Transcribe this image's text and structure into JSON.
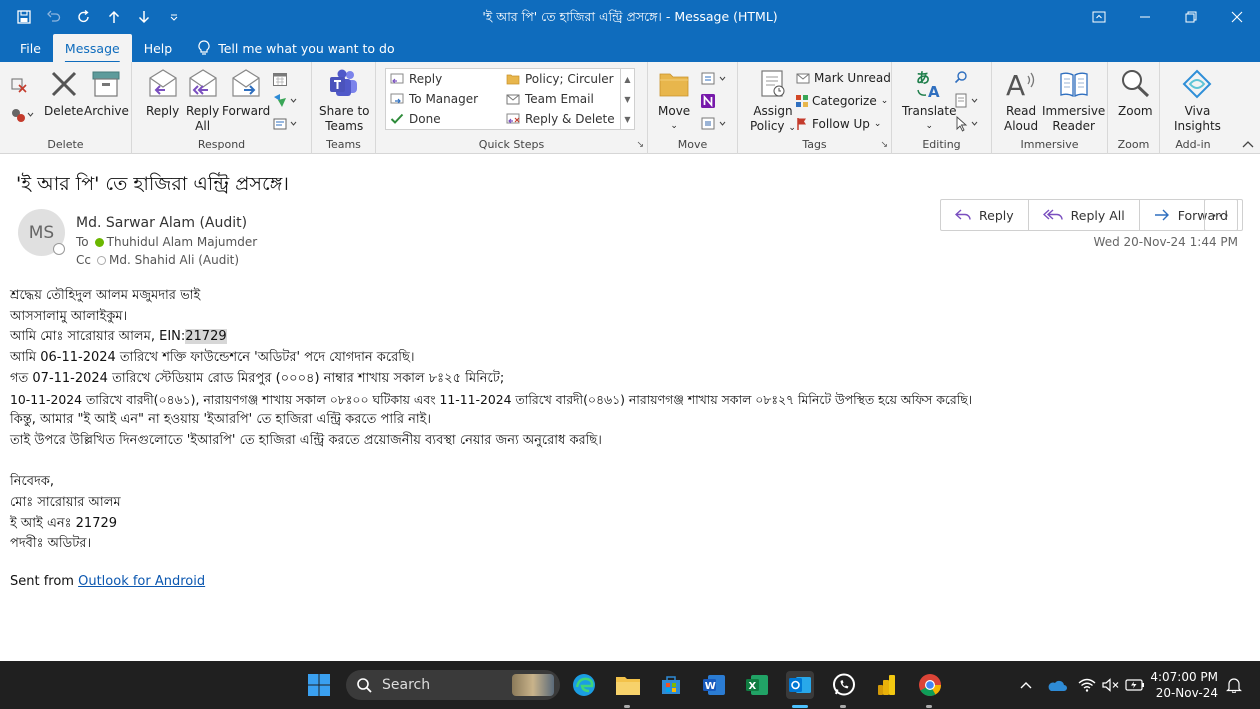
{
  "window": {
    "title": "'ই আর পি' তে হাজিরা এন্ট্রি প্রসঙ্গে। - Message (HTML)"
  },
  "menu": {
    "tabs": [
      "File",
      "Message",
      "Help"
    ],
    "tell_me": "Tell me what you want to do"
  },
  "ribbon": {
    "delete_group": {
      "label": "Delete",
      "delete": "Delete",
      "archive": "Archive"
    },
    "respond_group": {
      "label": "Respond",
      "reply": "Reply",
      "reply_all_1": "Reply",
      "reply_all_2": "All",
      "forward": "Forward"
    },
    "teams_group": {
      "label": "Teams",
      "share_1": "Share to",
      "share_2": "Teams"
    },
    "quick_steps": {
      "label": "Quick Steps",
      "items": [
        "Reply",
        "Policy; Circuler",
        "To Manager",
        "Team Email",
        "Done",
        "Reply & Delete"
      ]
    },
    "move_group": {
      "label": "Move",
      "move": "Move"
    },
    "tags_group": {
      "label": "Tags",
      "assign_1": "Assign",
      "assign_2": "Policy",
      "mark_unread": "Mark Unread",
      "categorize": "Categorize",
      "follow_up": "Follow Up"
    },
    "editing_group": {
      "label": "Editing",
      "translate": "Translate"
    },
    "immersive_group": {
      "label": "Immersive",
      "read_aloud_1": "Read",
      "read_aloud_2": "Aloud",
      "immersive_1": "Immersive",
      "immersive_2": "Reader"
    },
    "zoom_group": {
      "label": "Zoom",
      "zoom": "Zoom"
    },
    "addin_group": {
      "label": "Add-in",
      "viva_1": "Viva",
      "viva_2": "Insights"
    }
  },
  "message": {
    "subject": "'ই আর পি' তে হাজিরা এন্ট্রি প্রসঙ্গে।",
    "avatar_initials": "MS",
    "sender": "Md. Sarwar Alam (Audit)",
    "to_label": "To",
    "to": "Thuhidul Alam Majumder",
    "cc_label": "Cc",
    "cc": "Md. Shahid Ali (Audit)",
    "datetime": "Wed 20-Nov-24 1:44 PM",
    "actions": {
      "reply": "Reply",
      "reply_all": "Reply All",
      "forward": "Forward"
    },
    "body": {
      "line1": "শ্রদ্ধেয় তৌহিদুল আলম মজুমদার ভাই",
      "line2": "আসসালামু আলাইকুম।",
      "line3_prefix": "আমি মোঃ সারোয়ার আলম, EIN:",
      "line3_ein": "21729",
      "line4": "আমি 06-11-2024 তারিখে শক্তি ফাউন্ডেশনে 'অডিটর' পদে যোগদান করেছি।",
      "line5": "গত 07-11-2024 তারিখে স্টেডিয়াম রোড মিরপুর (০০০৪) নাম্বার শাখায় সকাল ৮ঃ২৫ মিনিটে;",
      "line6": "10-11-2024 তারিখে বারদী(০৪৬১), নারায়ণগঞ্জ শাখায় সকাল ০৮ঃ০০ ঘটিকায় এবং 11-11-2024 তারিখে বারদী(০৪৬১) নারায়ণগঞ্জ শাখায় সকাল ০৮ঃ২৭ মিনিটে উপস্থিত হয়ে অফিস করেছি।",
      "line7": "কিন্তু, আমার \"ই আই এন\" না হওয়ায় 'ইআরপি' তে হাজিরা এন্ট্রি করতে পারি নাই।",
      "line8": "তাই উপরে উল্লিখিত দিনগুলোতে 'ইআরপি' তে হাজিরা এন্ট্রি করতে প্রয়োজনীয় ব্যবস্থা নেয়ার জন্য অনুরোধ করছি।",
      "sig1": "নিবেদক,",
      "sig2": "মোঃ সারোয়ার আলম",
      "sig3": "ই আই এনঃ 21729",
      "sig4": "পদবীঃ অডিটর।"
    },
    "sent_from_prefix": "Sent from ",
    "sent_from_link": "Outlook for Android"
  },
  "taskbar": {
    "search_placeholder": "Search",
    "time": "4:07:00 PM",
    "date": "20-Nov-24"
  },
  "colors": {
    "titlebar": "#0f6cbd",
    "taskbar": "#202020",
    "ribbon": "#f3f3f3"
  }
}
